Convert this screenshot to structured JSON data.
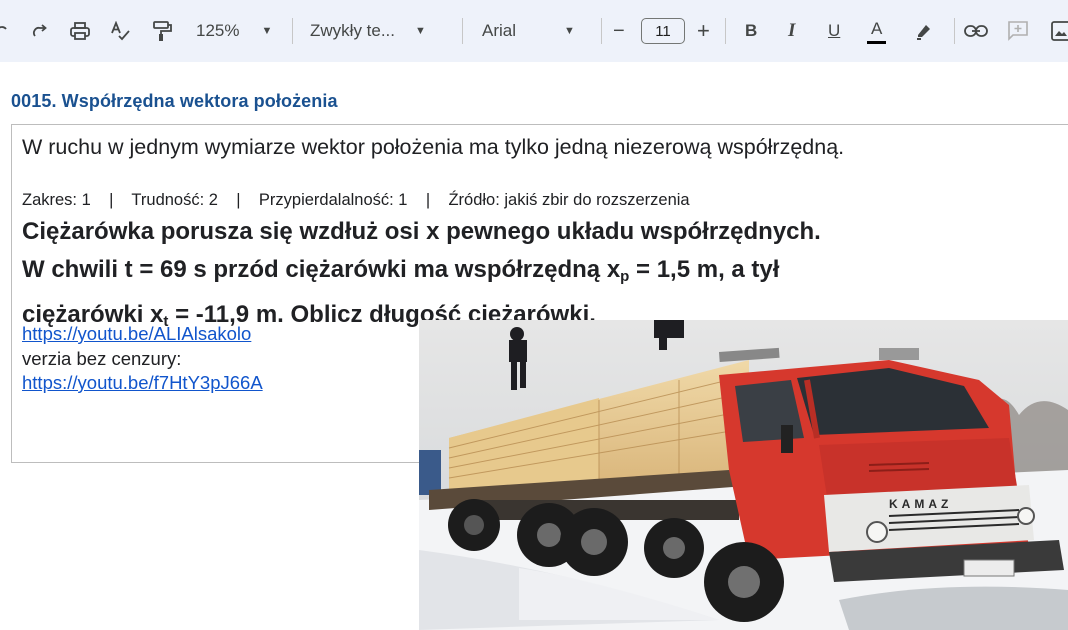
{
  "toolbar": {
    "zoom": "125%",
    "style": "Zwykły te...",
    "font": "Arial",
    "font_size": "11",
    "bold_label": "B",
    "italic_label": "I",
    "underline_label": "U",
    "text_color_label": "A",
    "decrease_label": "−",
    "increase_label": "+"
  },
  "document": {
    "heading": "0015. Współrzędna wektora położenia",
    "intro": "W ruchu w jednym wymiarze wektor położenia ma tylko jedną niezerową współrzędną.",
    "meta": "Zakres: 1    |    Trudność: 2    |    Przypierdalalność: 1    |    Źródło: jakiś zbir do rozszerzenia",
    "problem": {
      "line1": "Ciężarówka porusza się wzdłuż osi x pewnego układu współrzędnych.",
      "line2_a": "W chwili t = 69 s przód ciężarówki ma współrzędną x",
      "line2_sub": "p",
      "line2_b": " = 1,5 m, a tył",
      "line3_a": "ciężarówki x",
      "line3_sub": "t",
      "line3_b": " = -11,9 m. Oblicz długość ciężarówki."
    },
    "link1": "https://youtu.be/ALIAlsakolo",
    "uncensored_label": "verzia bez cenzury:",
    "link2": "https://youtu.be/f7HtY3pJ66A",
    "truck_brand": "KAMAZ"
  }
}
